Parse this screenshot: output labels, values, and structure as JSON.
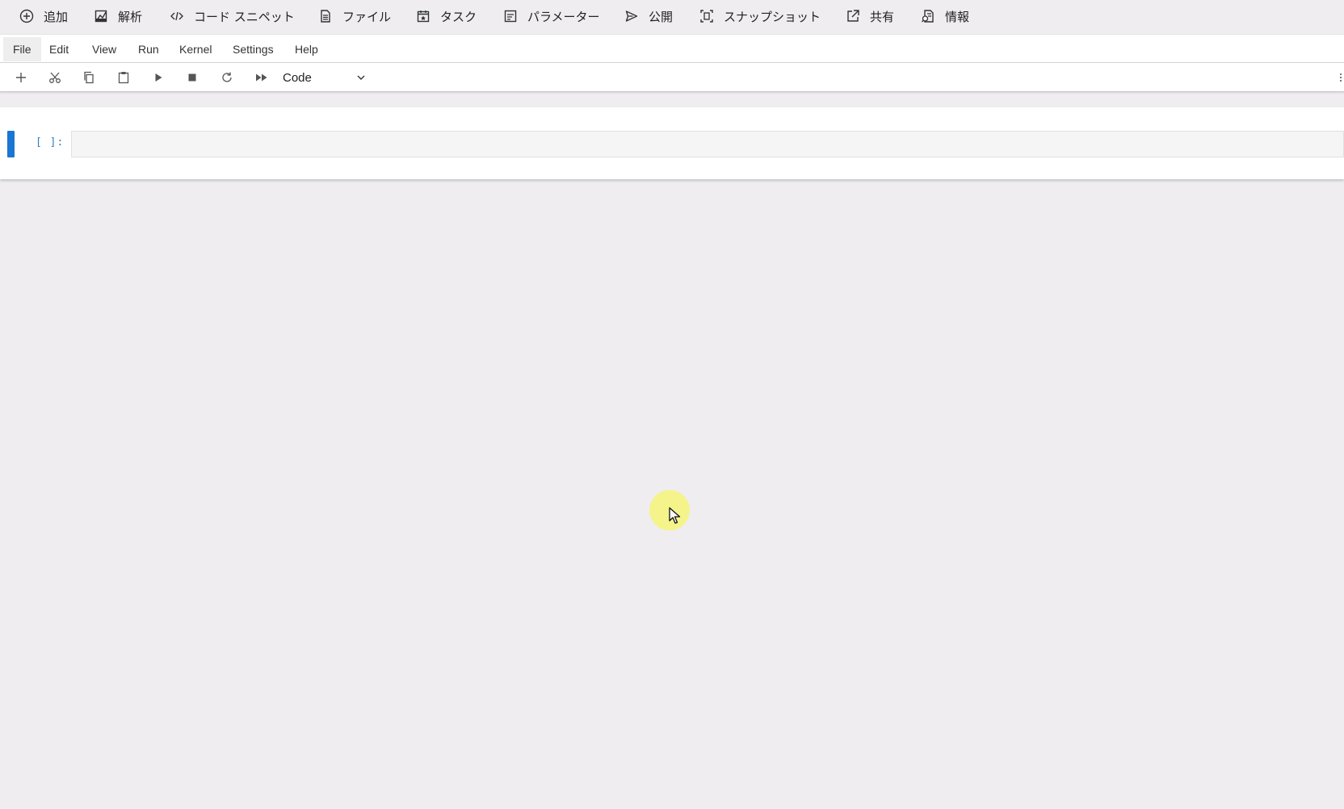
{
  "colors": {
    "background": "#efedf0",
    "accent": "#1976d2",
    "prompt": "#307fc1",
    "cursor_halo": "#f4f478"
  },
  "top_actions": [
    {
      "label": "追加",
      "icon": "add-circle-icon"
    },
    {
      "label": "解析",
      "icon": "analysis-icon"
    },
    {
      "label": "コード スニペット",
      "icon": "code-icon"
    },
    {
      "label": "ファイル",
      "icon": "file-icon"
    },
    {
      "label": "タスク",
      "icon": "calendar-task-icon"
    },
    {
      "label": "パラメーター",
      "icon": "parameters-icon"
    },
    {
      "label": "公開",
      "icon": "send-icon"
    },
    {
      "label": "スナップショット",
      "icon": "snapshot-icon"
    },
    {
      "label": "共有",
      "icon": "share-icon"
    },
    {
      "label": "情報",
      "icon": "info-document-icon"
    }
  ],
  "menu": {
    "items": [
      "File",
      "Edit",
      "View",
      "Run",
      "Kernel",
      "Settings",
      "Help"
    ],
    "active": "File"
  },
  "toolbar": {
    "buttons": [
      {
        "icon": "plus-icon"
      },
      {
        "icon": "scissors-icon"
      },
      {
        "icon": "copy-icon"
      },
      {
        "icon": "paste-icon"
      },
      {
        "icon": "run-icon"
      },
      {
        "icon": "stop-icon"
      },
      {
        "icon": "restart-icon"
      },
      {
        "icon": "fast-forward-icon"
      }
    ],
    "cell_type": "Code"
  },
  "cell": {
    "prompt": "[ ]:",
    "content": ""
  }
}
